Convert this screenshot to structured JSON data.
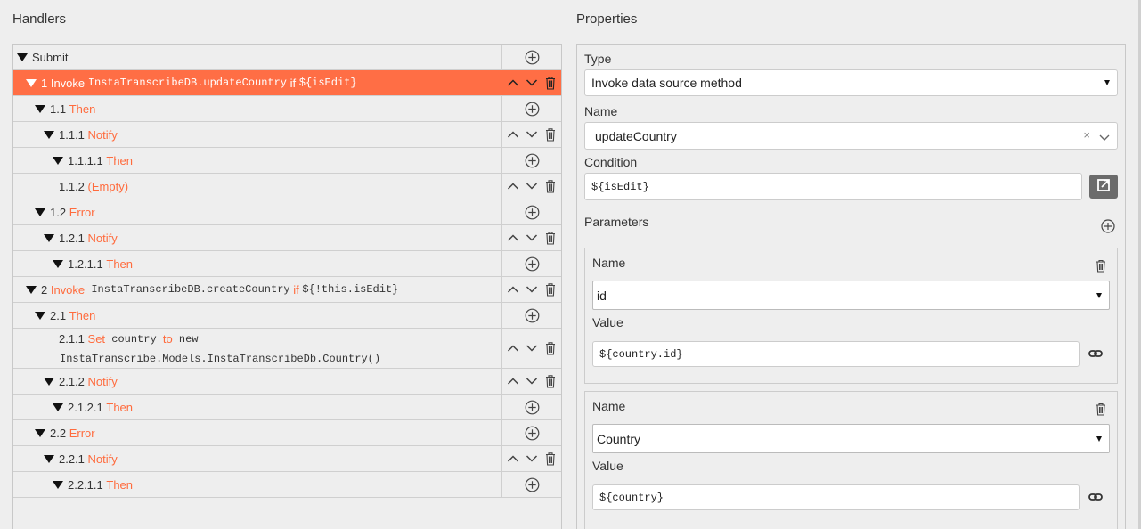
{
  "handlers": {
    "title": "Handlers",
    "rows": [
      {
        "indent": 0,
        "caret": true,
        "parts": [
          {
            "t": "Submit",
            "c": ""
          }
        ],
        "actions": "add",
        "selected": false
      },
      {
        "indent": 1,
        "caret": true,
        "parts": [
          {
            "t": "1 Invoke ",
            "c": ""
          },
          {
            "t": "InstaTranscribeDB.updateCountry",
            "c": "mono"
          },
          {
            "t": " if ",
            "c": ""
          },
          {
            "t": "${isEdit}",
            "c": "mono"
          }
        ],
        "actions": "move",
        "selected": true
      },
      {
        "indent": 2,
        "caret": true,
        "parts": [
          {
            "t": "1.1 ",
            "c": ""
          },
          {
            "t": "Then",
            "c": "accent"
          }
        ],
        "actions": "add",
        "selected": false
      },
      {
        "indent": 3,
        "caret": true,
        "parts": [
          {
            "t": "1.1.1 ",
            "c": ""
          },
          {
            "t": "Notify",
            "c": "accent"
          }
        ],
        "actions": "move",
        "selected": false
      },
      {
        "indent": 4,
        "caret": true,
        "parts": [
          {
            "t": "1.1.1.1 ",
            "c": ""
          },
          {
            "t": "Then",
            "c": "accent"
          }
        ],
        "actions": "add",
        "selected": false
      },
      {
        "indent": 3,
        "caret": false,
        "parts": [
          {
            "t": "1.1.2 ",
            "c": ""
          },
          {
            "t": "(Empty)",
            "c": "accent"
          }
        ],
        "actions": "move",
        "selected": false
      },
      {
        "indent": 2,
        "caret": true,
        "parts": [
          {
            "t": "1.2 ",
            "c": ""
          },
          {
            "t": "Error",
            "c": "accent"
          }
        ],
        "actions": "add",
        "selected": false
      },
      {
        "indent": 3,
        "caret": true,
        "parts": [
          {
            "t": "1.2.1 ",
            "c": ""
          },
          {
            "t": "Notify",
            "c": "accent"
          }
        ],
        "actions": "move",
        "selected": false
      },
      {
        "indent": 4,
        "caret": true,
        "parts": [
          {
            "t": "1.2.1.1 ",
            "c": ""
          },
          {
            "t": "Then",
            "c": "accent"
          }
        ],
        "actions": "add",
        "selected": false
      },
      {
        "indent": 1,
        "caret": true,
        "parts": [
          {
            "t": "2 ",
            "c": ""
          },
          {
            "t": "Invoke",
            "c": "accent"
          },
          {
            "t": " InstaTranscribeDB.createCountry",
            "c": "mono"
          },
          {
            "t": " if ",
            "c": "accent"
          },
          {
            "t": "${!this.isEdit}",
            "c": "mono"
          }
        ],
        "actions": "move",
        "selected": false
      },
      {
        "indent": 2,
        "caret": true,
        "parts": [
          {
            "t": "2.1 ",
            "c": ""
          },
          {
            "t": "Then",
            "c": "accent"
          }
        ],
        "actions": "add",
        "selected": false
      },
      {
        "indent": 3,
        "caret": false,
        "tall": true,
        "parts": [
          {
            "t": "2.1.1 ",
            "c": ""
          },
          {
            "t": "Set",
            "c": "accent"
          },
          {
            "t": " country ",
            "c": "mono"
          },
          {
            "t": "to",
            "c": "accent"
          },
          {
            "t": " new",
            "c": "mono"
          }
        ],
        "line2": "InstaTranscribe.Models.InstaTranscribeDb.Country()",
        "actions": "move",
        "selected": false
      },
      {
        "indent": 3,
        "caret": true,
        "parts": [
          {
            "t": "2.1.2 ",
            "c": ""
          },
          {
            "t": "Notify",
            "c": "accent"
          }
        ],
        "actions": "move",
        "selected": false
      },
      {
        "indent": 4,
        "caret": true,
        "parts": [
          {
            "t": "2.1.2.1 ",
            "c": ""
          },
          {
            "t": "Then",
            "c": "accent"
          }
        ],
        "actions": "add",
        "selected": false
      },
      {
        "indent": 2,
        "caret": true,
        "parts": [
          {
            "t": "2.2 ",
            "c": ""
          },
          {
            "t": "Error",
            "c": "accent"
          }
        ],
        "actions": "add",
        "selected": false
      },
      {
        "indent": 3,
        "caret": true,
        "parts": [
          {
            "t": "2.2.1 ",
            "c": ""
          },
          {
            "t": "Notify",
            "c": "accent"
          }
        ],
        "actions": "move",
        "selected": false
      },
      {
        "indent": 4,
        "caret": true,
        "parts": [
          {
            "t": "2.2.1.1 ",
            "c": ""
          },
          {
            "t": "Then",
            "c": "accent"
          }
        ],
        "actions": "add",
        "selected": false
      }
    ]
  },
  "properties": {
    "title": "Properties",
    "type_label": "Type",
    "type_value": "Invoke data source method",
    "name_label": "Name",
    "name_value": "updateCountry",
    "name_clear": "×",
    "condition_label": "Condition",
    "condition_value": "${isEdit}",
    "parameters_label": "Parameters",
    "params": [
      {
        "name_label": "Name",
        "name_value": "id",
        "value_label": "Value",
        "value": "${country.id}"
      },
      {
        "name_label": "Name",
        "name_value": "Country",
        "value_label": "Value",
        "value": "${country}"
      }
    ]
  },
  "colors": {
    "accent": "#ff6b3d",
    "selected_row": "#ff6e45",
    "icon": "#444444"
  },
  "icons": {
    "add": "circle-plus-icon",
    "up": "chevron-up-icon",
    "down": "chevron-down-icon",
    "delete": "trash-icon",
    "open": "external-link-icon",
    "link": "link-icon"
  }
}
